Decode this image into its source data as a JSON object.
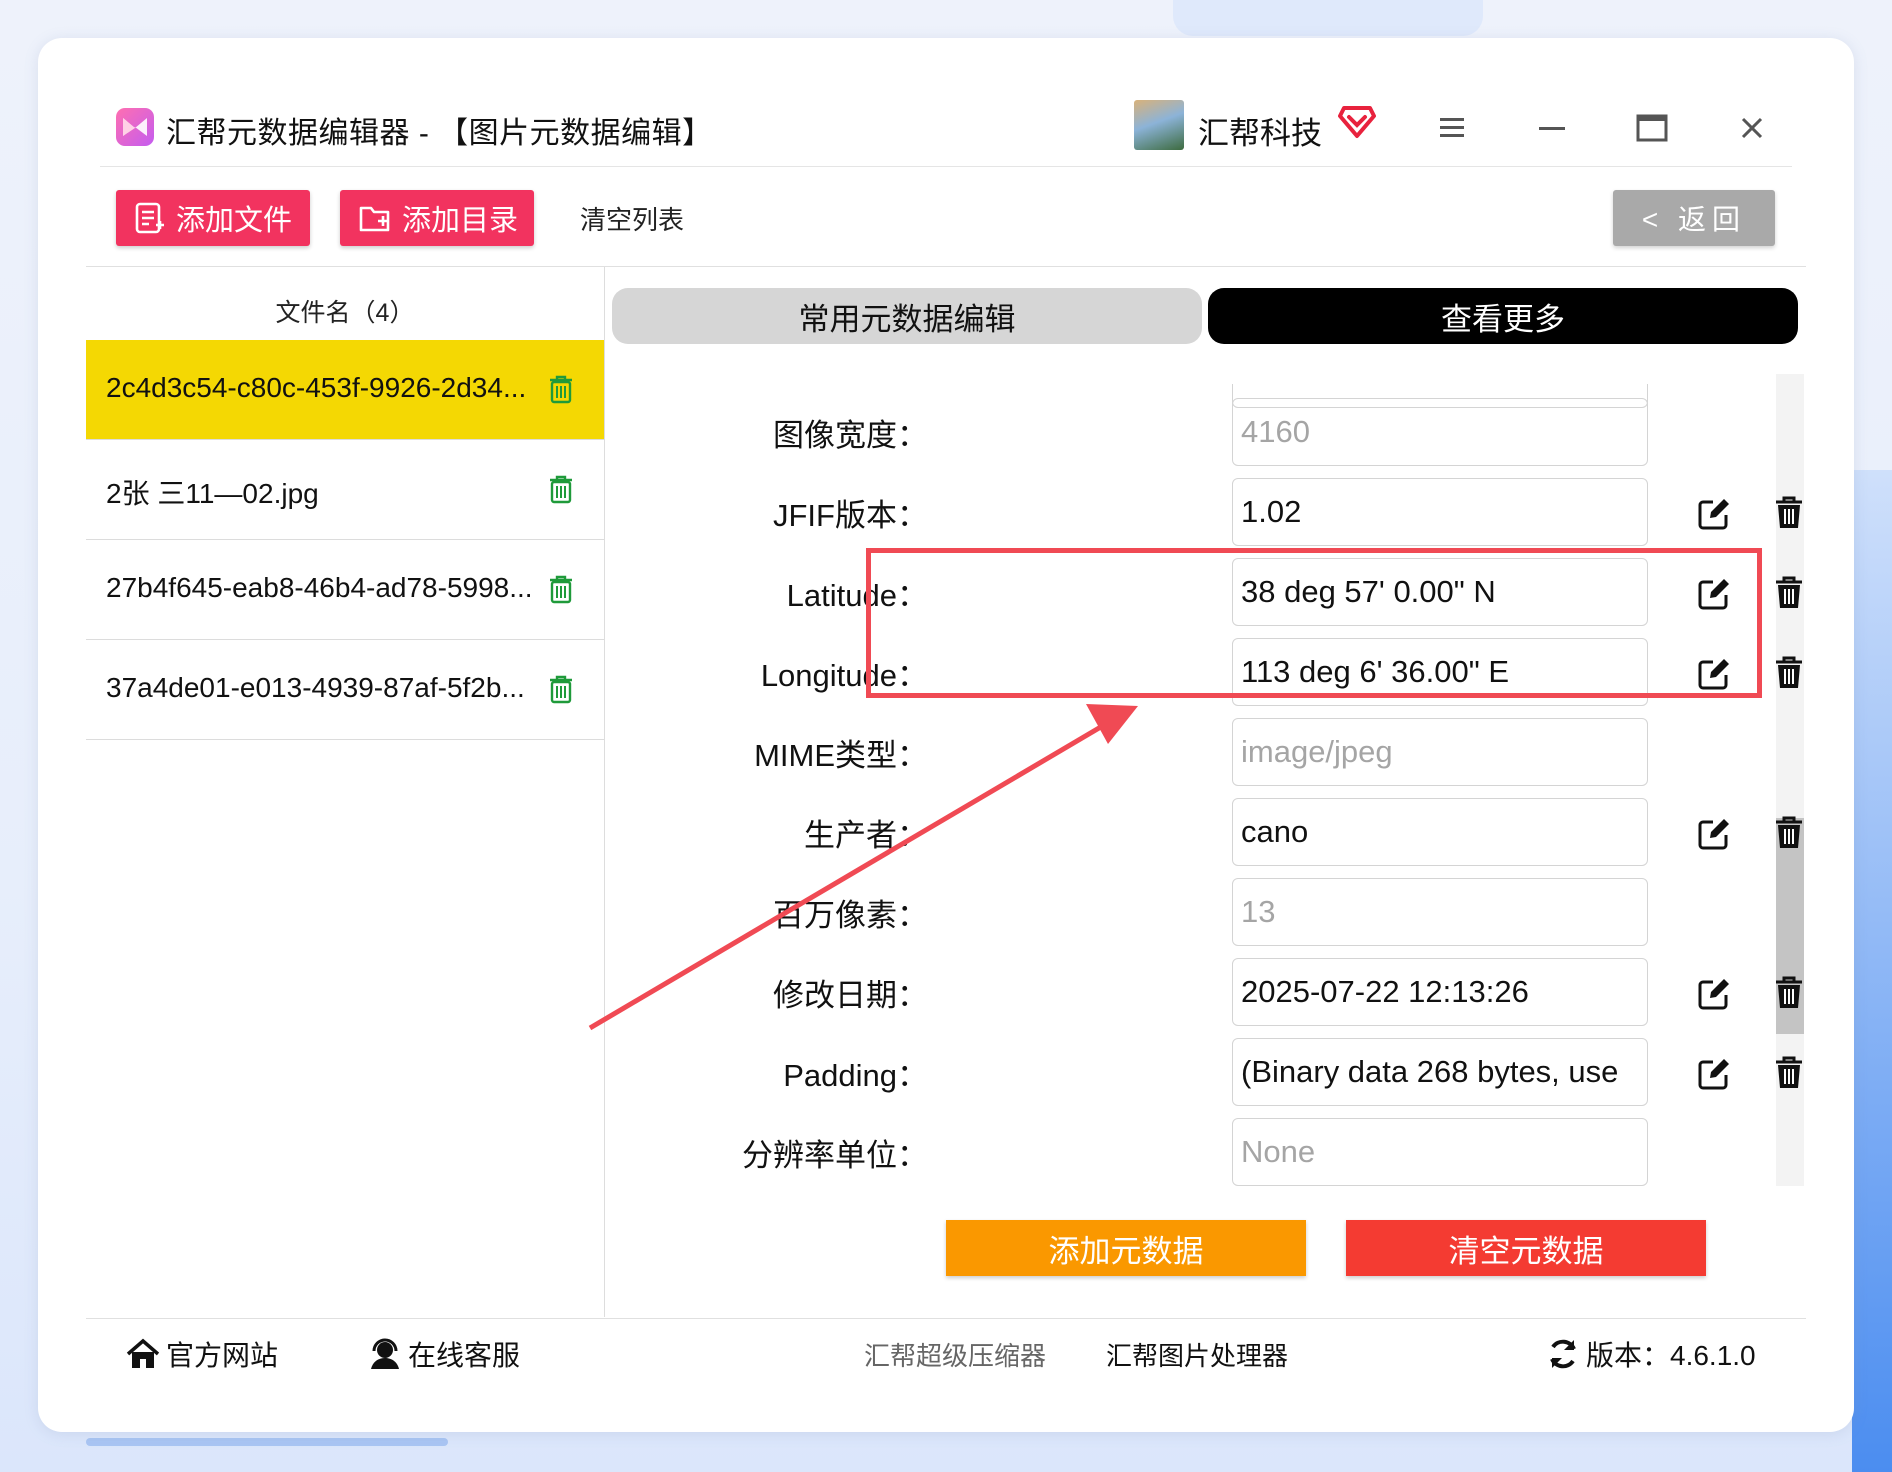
{
  "window": {
    "title": "汇帮元数据编辑器 - 【图片元数据编辑】",
    "company": "汇帮科技"
  },
  "toolbar": {
    "add_file": "添加文件",
    "add_dir": "添加目录",
    "clear_list": "清空列表",
    "back": "< 返回"
  },
  "file_list": {
    "header": "文件名（4）",
    "items": [
      {
        "name": "2c4d3c54-c80c-453f-9926-2d34..."
      },
      {
        "name": "2张 三11—02.jpg"
      },
      {
        "name": "27b4f645-eab8-46b4-ad78-5998..."
      },
      {
        "name": "37a4de01-e013-4939-87af-5f2b..."
      }
    ]
  },
  "tabs": {
    "common": "常用元数据编辑",
    "more": "查看更多"
  },
  "fields": [
    {
      "label": "图像宽度：",
      "value": "4160",
      "editable": false
    },
    {
      "label": "JFIF版本：",
      "value": "1.02",
      "editable": true
    },
    {
      "label": "Latitude：",
      "value": "38 deg 57' 0.00\" N",
      "editable": true
    },
    {
      "label": "Longitude：",
      "value": "113 deg 6' 36.00\" E",
      "editable": true
    },
    {
      "label": "MIME类型：",
      "value": "image/jpeg",
      "editable": false
    },
    {
      "label": "生产者：",
      "value": "cano",
      "editable": true
    },
    {
      "label": "百万像素：",
      "value": "13",
      "editable": false
    },
    {
      "label": "修改日期：",
      "value": "2025-07-22 12:13:26",
      "editable": true
    },
    {
      "label": "Padding：",
      "value": "(Binary data 268 bytes, use",
      "editable": true
    },
    {
      "label": "分辨率单位：",
      "value": "None",
      "editable": false
    }
  ],
  "actions": {
    "add_meta": "添加元数据",
    "clear_meta": "清空元数据"
  },
  "footer": {
    "website": "官方网站",
    "support": "在线客服",
    "compressor": "汇帮超级压缩器",
    "image_tool": "汇帮图片处理器",
    "version": "版本：4.6.1.0"
  },
  "colors": {
    "pink": "#f2335f",
    "selected_row": "#f4d803",
    "highlight": "#f04a54",
    "add_button": "#fa9800",
    "clear_button": "#f43b32"
  }
}
